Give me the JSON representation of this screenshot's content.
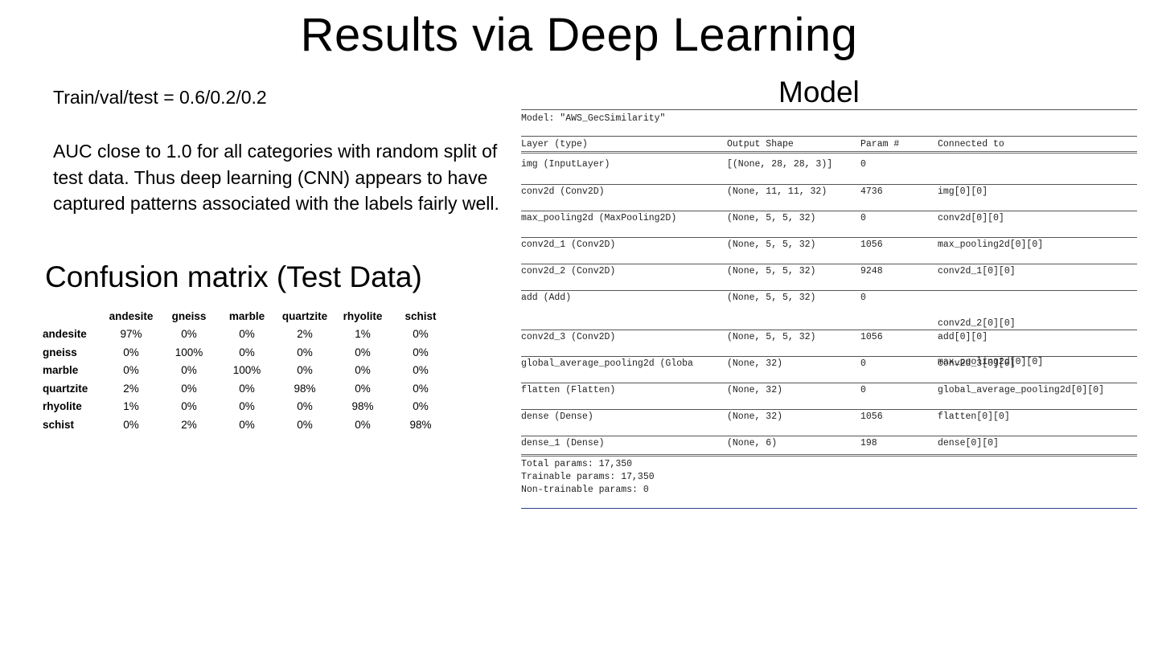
{
  "slide": {
    "title": "Results via Deep Learning",
    "split_text": "Train/val/test = 0.6/0.2/0.2",
    "auc_text": "AUC close to 1.0 for all categories with random split of test data.  Thus deep learning (CNN) appears to have captured patterns associated with the labels fairly well.",
    "confusion_heading": "Confusion matrix (Test Data)",
    "model_heading": "Model"
  },
  "confusion_matrix": {
    "columns": [
      "andesite",
      "gneiss",
      "marble",
      "quartzite",
      "rhyolite",
      "schist"
    ],
    "rows": [
      {
        "label": "andesite",
        "values": [
          "97%",
          "0%",
          "0%",
          "2%",
          "1%",
          "0%"
        ]
      },
      {
        "label": "gneiss",
        "values": [
          "0%",
          "100%",
          "0%",
          "0%",
          "0%",
          "0%"
        ]
      },
      {
        "label": "marble",
        "values": [
          "0%",
          "0%",
          "100%",
          "0%",
          "0%",
          "0%"
        ]
      },
      {
        "label": "quartzite",
        "values": [
          "2%",
          "0%",
          "0%",
          "98%",
          "0%",
          "0%"
        ]
      },
      {
        "label": "rhyolite",
        "values": [
          "1%",
          "0%",
          "0%",
          "0%",
          "98%",
          "0%"
        ]
      },
      {
        "label": "schist",
        "values": [
          "0%",
          "2%",
          "0%",
          "0%",
          "0%",
          "98%"
        ]
      }
    ]
  },
  "model_summary": {
    "model_name_line": "Model: \"AWS_GecSimilarity\"",
    "headers": [
      "Layer (type)",
      "Output Shape",
      "Param #",
      "Connected to"
    ],
    "layers": [
      {
        "layer": "img (InputLayer)",
        "shape": "[(None, 28, 28, 3)]",
        "params": "0",
        "connected": ""
      },
      {
        "layer": "conv2d (Conv2D)",
        "shape": "(None, 11, 11, 32)",
        "params": "4736",
        "connected": "img[0][0]"
      },
      {
        "layer": "max_pooling2d (MaxPooling2D)",
        "shape": "(None, 5, 5, 32)",
        "params": "0",
        "connected": "conv2d[0][0]"
      },
      {
        "layer": "conv2d_1 (Conv2D)",
        "shape": "(None, 5, 5, 32)",
        "params": "1056",
        "connected": "max_pooling2d[0][0]"
      },
      {
        "layer": "conv2d_2 (Conv2D)",
        "shape": "(None, 5, 5, 32)",
        "params": "9248",
        "connected": "conv2d_1[0][0]"
      },
      {
        "layer": "add (Add)",
        "shape": "(None, 5, 5, 32)",
        "params": "0",
        "connected": "conv2d_2[0][0]",
        "connected_2": "max_pooling2d[0][0]"
      },
      {
        "layer": "conv2d_3 (Conv2D)",
        "shape": "(None, 5, 5, 32)",
        "params": "1056",
        "connected": "add[0][0]"
      },
      {
        "layer": "global_average_pooling2d (Globa",
        "shape": "(None, 32)",
        "params": "0",
        "connected": "conv2d_3[0][0]"
      },
      {
        "layer": "flatten (Flatten)",
        "shape": "(None, 32)",
        "params": "0",
        "connected": "global_average_pooling2d[0][0]"
      },
      {
        "layer": "dense (Dense)",
        "shape": "(None, 32)",
        "params": "1056",
        "connected": "flatten[0][0]"
      },
      {
        "layer": "dense_1 (Dense)",
        "shape": "(None, 6)",
        "params": "198",
        "connected": "dense[0][0]"
      }
    ],
    "total_params": "Total params: 17,350",
    "trainable_params": "Trainable params: 17,350",
    "non_trainable_params": "Non-trainable params: 0"
  }
}
